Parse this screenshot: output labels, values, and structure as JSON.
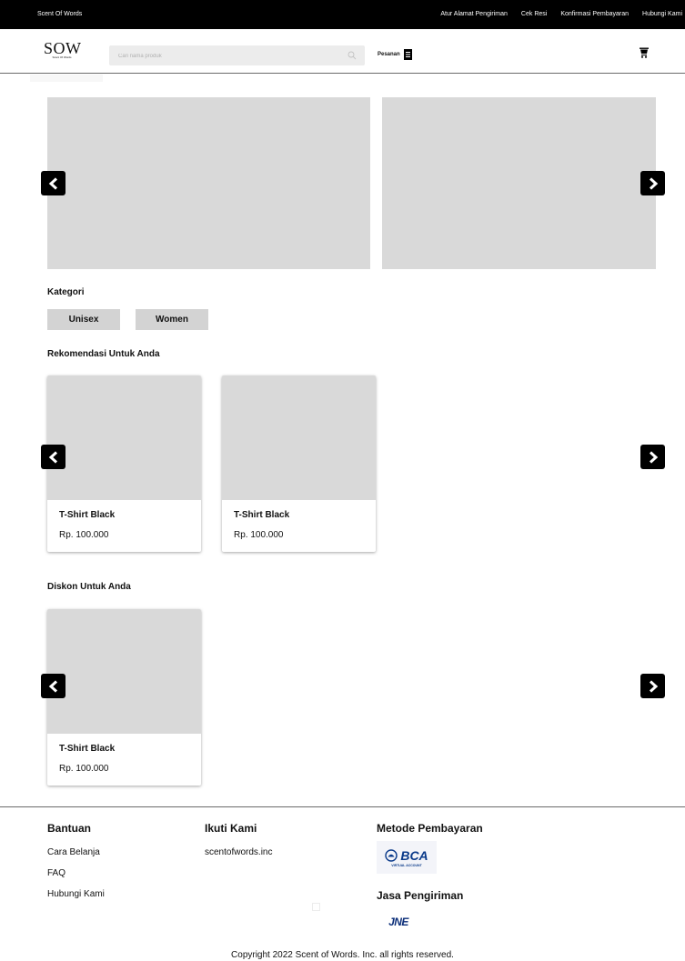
{
  "topbar": {
    "brand": "Scent Of Words",
    "links": [
      "Atur Alamat Pengiriman",
      "Cek Resi",
      "Konfirmasi Pembayaran",
      "Hubungi Kami"
    ]
  },
  "header": {
    "logo_big": "SOW",
    "logo_small": "Scent Of Words",
    "search_placeholder": "Cari nama produk",
    "pesanan_label": "Pesanan"
  },
  "kategori": {
    "title": "Kategori",
    "chips": [
      "Unisex",
      "Women"
    ]
  },
  "rekomendasi": {
    "title": "Rekomendasi Untuk Anda",
    "products": [
      {
        "name": "T-Shirt Black",
        "price": "Rp. 100.000"
      },
      {
        "name": "T-Shirt Black",
        "price": "Rp. 100.000"
      }
    ]
  },
  "diskon": {
    "title": "Diskon Untuk Anda",
    "products": [
      {
        "name": "T-Shirt Black",
        "price": "Rp. 100.000"
      }
    ]
  },
  "footer": {
    "bantuan_title": "Bantuan",
    "bantuan_links": [
      "Cara Belanja",
      "FAQ",
      "Hubungi Kami"
    ],
    "ikuti_title": "Ikuti Kami",
    "ikuti_link": "scentofwords.inc",
    "metode_title": "Metode Pembayaran",
    "bca_text": "BCA",
    "bca_sub": "VIRTUAL ACCOUNT",
    "jasa_title": "Jasa Pengiriman",
    "jne_text": "JNE",
    "copyright": "Copyright 2022 Scent of Words. Inc. all rights reserved."
  },
  "icons": {
    "search": "search-icon",
    "pesanan": "document-icon",
    "cart": "cart-icon",
    "prev": "chevron-left-icon",
    "next": "chevron-right-icon"
  },
  "colors": {
    "topbar_bg": "#000000",
    "placeholder_bg": "#d9d9d9",
    "chip_bg": "#d3d3d3",
    "bca_blue": "#0a3a8a"
  }
}
